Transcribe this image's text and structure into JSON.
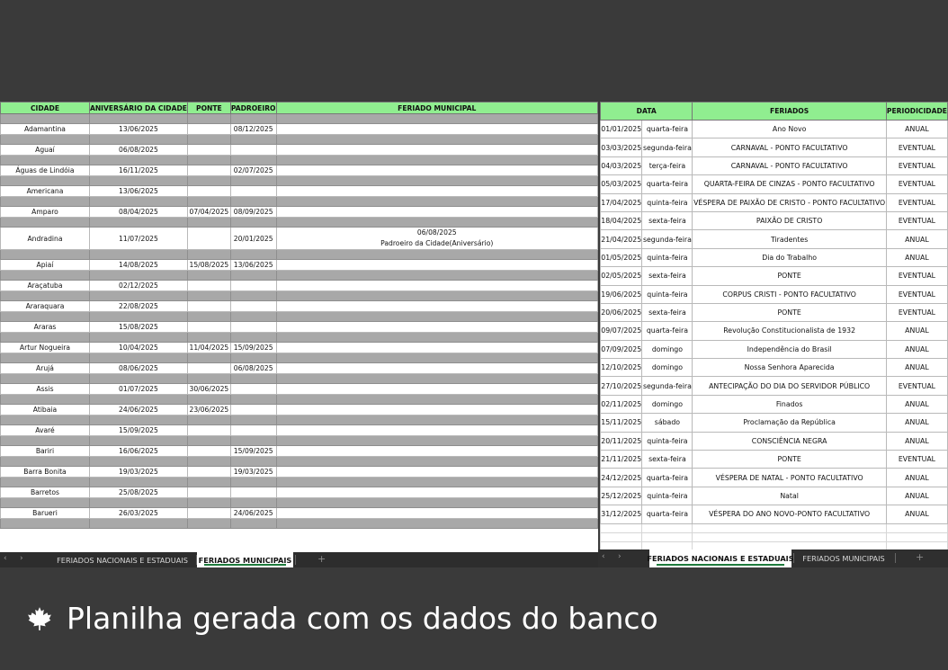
{
  "left_sheet": {
    "headers": [
      "CIDADE",
      "ANIVERSÁRIO DA CIDADE",
      "PONTE",
      "PADROEIRO",
      "FERIADO MUNICIPAL"
    ],
    "rows": [
      {
        "cidade": "Adamantina",
        "aniversario": "13/06/2025",
        "ponte": "",
        "padroeiro": "08/12/2025",
        "feriado": ""
      },
      {
        "cidade": "Aguaí",
        "aniversario": "06/08/2025",
        "ponte": "",
        "padroeiro": "",
        "feriado": ""
      },
      {
        "cidade": "Águas de Lindóia",
        "aniversario": "16/11/2025",
        "ponte": "",
        "padroeiro": "02/07/2025",
        "feriado": ""
      },
      {
        "cidade": "Americana",
        "aniversario": "13/06/2025",
        "ponte": "",
        "padroeiro": "",
        "feriado": ""
      },
      {
        "cidade": "Amparo",
        "aniversario": "08/04/2025",
        "ponte": "07/04/2025",
        "padroeiro": "08/09/2025",
        "feriado": ""
      },
      {
        "cidade": "Andradina",
        "aniversario": "11/07/2025",
        "ponte": "",
        "padroeiro": "20/01/2025",
        "feriado": "06/08/2025",
        "feriado2": "Padroeiro da Cidade(Aniversário)"
      },
      {
        "cidade": "Apiaí",
        "aniversario": "14/08/2025",
        "ponte": "15/08/2025",
        "padroeiro": "13/06/2025",
        "feriado": ""
      },
      {
        "cidade": "Araçatuba",
        "aniversario": "02/12/2025",
        "ponte": "",
        "padroeiro": "",
        "feriado": ""
      },
      {
        "cidade": "Araraquara",
        "aniversario": "22/08/2025",
        "ponte": "",
        "padroeiro": "",
        "feriado": ""
      },
      {
        "cidade": "Araras",
        "aniversario": "15/08/2025",
        "ponte": "",
        "padroeiro": "",
        "feriado": ""
      },
      {
        "cidade": "Artur Nogueira",
        "aniversario": "10/04/2025",
        "ponte": "11/04/2025",
        "padroeiro": "15/09/2025",
        "feriado": ""
      },
      {
        "cidade": "Arujá",
        "aniversario": "08/06/2025",
        "ponte": "",
        "padroeiro": "06/08/2025",
        "feriado": ""
      },
      {
        "cidade": "Assis",
        "aniversario": "01/07/2025",
        "ponte": "30/06/2025",
        "padroeiro": "",
        "feriado": ""
      },
      {
        "cidade": "Atibaia",
        "aniversario": "24/06/2025",
        "ponte": "23/06/2025",
        "padroeiro": "",
        "feriado": ""
      },
      {
        "cidade": "Avaré",
        "aniversario": "15/09/2025",
        "ponte": "",
        "padroeiro": "",
        "feriado": ""
      },
      {
        "cidade": "Bariri",
        "aniversario": "16/06/2025",
        "ponte": "",
        "padroeiro": "15/09/2025",
        "feriado": ""
      },
      {
        "cidade": "Barra Bonita",
        "aniversario": "19/03/2025",
        "ponte": "",
        "padroeiro": "19/03/2025",
        "feriado": ""
      },
      {
        "cidade": "Barretos",
        "aniversario": "25/08/2025",
        "ponte": "",
        "padroeiro": "",
        "feriado": ""
      },
      {
        "cidade": "Barueri",
        "aniversario": "26/03/2025",
        "ponte": "",
        "padroeiro": "24/06/2025",
        "feriado": ""
      }
    ],
    "tabs": [
      {
        "label": "FERIADOS NACIONAIS E ESTADUAIS",
        "active": false
      },
      {
        "label": "FERIADOS MUNICIPAIS",
        "active": true
      }
    ],
    "add_sheet": "+"
  },
  "right_sheet": {
    "headers": [
      "DATA",
      "FERIADOS",
      "PERIODICIDADE"
    ],
    "rows": [
      {
        "data": "01/01/2025",
        "dia": "quarta-feira",
        "feriado": "Ano Novo",
        "periodicidade": "ANUAL"
      },
      {
        "data": "03/03/2025",
        "dia": "segunda-feira",
        "feriado": "CARNAVAL - PONTO FACULTATIVO",
        "periodicidade": "EVENTUAL"
      },
      {
        "data": "04/03/2025",
        "dia": "terça-feira",
        "feriado": "CARNAVAL - PONTO FACULTATIVO",
        "periodicidade": "EVENTUAL"
      },
      {
        "data": "05/03/2025",
        "dia": "quarta-feira",
        "feriado": "QUARTA-FEIRA DE CINZAS - PONTO FACULTATIVO",
        "periodicidade": "EVENTUAL"
      },
      {
        "data": "17/04/2025",
        "dia": "quinta-feira",
        "feriado": "VÉSPERA DE PAIXÃO DE CRISTO - PONTO FACULTATIVO",
        "periodicidade": "EVENTUAL"
      },
      {
        "data": "18/04/2025",
        "dia": "sexta-feira",
        "feriado": "PAIXÃO DE CRISTO",
        "periodicidade": "EVENTUAL"
      },
      {
        "data": "21/04/2025",
        "dia": "segunda-feira",
        "feriado": "Tiradentes",
        "periodicidade": "ANUAL"
      },
      {
        "data": "01/05/2025",
        "dia": "quinta-feira",
        "feriado": "Dia do Trabalho",
        "periodicidade": "ANUAL"
      },
      {
        "data": "02/05/2025",
        "dia": "sexta-feira",
        "feriado": "PONTE",
        "periodicidade": "EVENTUAL"
      },
      {
        "data": "19/06/2025",
        "dia": "quinta-feira",
        "feriado": "CORPUS CRISTI - PONTO FACULTATIVO",
        "periodicidade": "EVENTUAL"
      },
      {
        "data": "20/06/2025",
        "dia": "sexta-feira",
        "feriado": "PONTE",
        "periodicidade": "EVENTUAL"
      },
      {
        "data": "09/07/2025",
        "dia": "quarta-feira",
        "feriado": "Revolução Constitucionalista de 1932",
        "periodicidade": "ANUAL"
      },
      {
        "data": "07/09/2025",
        "dia": "domingo",
        "feriado": "Independência do Brasil",
        "periodicidade": "ANUAL"
      },
      {
        "data": "12/10/2025",
        "dia": "domingo",
        "feriado": "Nossa Senhora Aparecida",
        "periodicidade": "ANUAL"
      },
      {
        "data": "27/10/2025",
        "dia": "segunda-feira",
        "feriado": "ANTECIPAÇÃO DO DIA DO SERVIDOR PÚBLICO",
        "periodicidade": "EVENTUAL"
      },
      {
        "data": "02/11/2025",
        "dia": "domingo",
        "feriado": "Finados",
        "periodicidade": "ANUAL"
      },
      {
        "data": "15/11/2025",
        "dia": "sábado",
        "feriado": "Proclamação da República",
        "periodicidade": "ANUAL"
      },
      {
        "data": "20/11/2025",
        "dia": "quinta-feira",
        "feriado": "CONSCIÊNCIA NEGRA",
        "periodicidade": "ANUAL"
      },
      {
        "data": "21/11/2025",
        "dia": "sexta-feira",
        "feriado": "PONTE",
        "periodicidade": "EVENTUAL"
      },
      {
        "data": "24/12/2025",
        "dia": "quarta-feira",
        "feriado": "VÉSPERA DE NATAL - PONTO FACULTATIVO",
        "periodicidade": "ANUAL"
      },
      {
        "data": "25/12/2025",
        "dia": "quinta-feira",
        "feriado": "Natal",
        "periodicidade": "ANUAL"
      },
      {
        "data": "31/12/2025",
        "dia": "quarta-feira",
        "feriado": "VÉSPERA DO ANO NOVO-PONTO FACULTATIVO",
        "periodicidade": "ANUAL"
      }
    ],
    "tabs": [
      {
        "label": "FERIADOS NACIONAIS E ESTADUAIS",
        "active": true
      },
      {
        "label": "FERIADOS MUNICIPAIS",
        "active": false
      }
    ],
    "add_sheet": "+"
  },
  "nav": {
    "prev": "‹",
    "next": "›"
  },
  "caption": {
    "icon": "maple-leaf-icon",
    "text": "Planilha gerada com os dados do banco"
  },
  "colors": {
    "header_green": "#90ee90",
    "gap_gray": "#a8a8a8",
    "background": "#3a3a3a",
    "tab_underline": "#1e7b3c"
  }
}
